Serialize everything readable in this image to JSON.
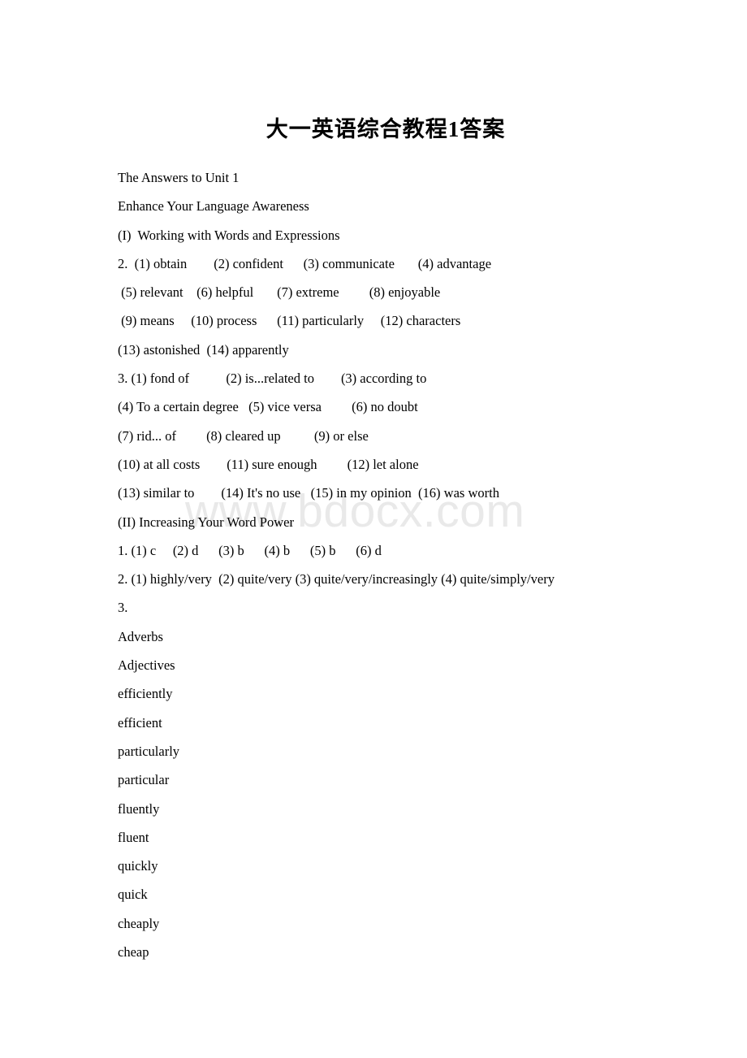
{
  "document": {
    "title": "大一英语综合教程1答案",
    "watermark": "www.bdocx.com",
    "lines": [
      "The Answers to Unit 1",
      "Enhance Your Language Awareness",
      "(I)  Working with Words and Expressions",
      "2.  (1) obtain        (2) confident      (3) communicate       (4) advantage",
      " (5) relevant    (6) helpful       (7) extreme         (8) enjoyable",
      " (9) means     (10) process      (11) particularly     (12) characters",
      "(13) astonished  (14) apparently",
      "3. (1) fond of           (2) is...related to        (3) according to",
      "(4) To a certain degree   (5) vice versa         (6) no doubt",
      "(7) rid... of         (8) cleared up          (9) or else",
      "(10) at all costs        (11) sure enough         (12) let alone",
      "(13) similar to        (14) It's no use   (15) in my opinion  (16) was worth",
      "(II) Increasing Your Word Power",
      "1. (1) c     (2) d      (3) b      (4) b      (5) b      (6) d",
      "2. (1) highly/very  (2) quite/very (3) quite/very/increasingly (4) quite/simply/very",
      "3.",
      "Adverbs",
      "Adjectives",
      "efficiently",
      "efficient",
      "particularly",
      "particular",
      "fluently",
      "fluent",
      "quickly",
      "quick",
      "cheaply",
      "cheap"
    ]
  }
}
